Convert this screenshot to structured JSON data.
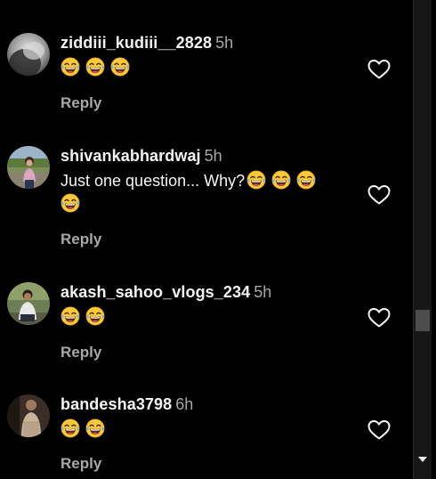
{
  "colors": {
    "background": "#000000",
    "text": "#f5f5f5",
    "secondary": "#a8a8a8",
    "scrollbar_track": "#171717",
    "scrollbar_thumb": "#4d4d4d"
  },
  "comments": [
    {
      "username": "ziddiii_kudiii__2828",
      "time": "5h",
      "text": "",
      "emoji_count": 3,
      "reply_label": "Reply",
      "avatar": "grey-blurred-avatar"
    },
    {
      "username": "shivankabhardwaj",
      "time": "5h",
      "text": "Just one question... Why?",
      "emoji_count": 4,
      "reply_label": "Reply",
      "avatar": "outdoor-photo-avatar"
    },
    {
      "username": "akash_sahoo_vlogs_234",
      "time": "5h",
      "text": "",
      "emoji_count": 2,
      "reply_label": "Reply",
      "avatar": "person-photo-avatar"
    },
    {
      "username": "bandesha3798",
      "time": "6h",
      "text": "",
      "emoji_count": 2,
      "reply_label": "Reply",
      "avatar": "person-photo-avatar"
    }
  ],
  "icons": {
    "emoji": "face-with-tears-of-joy-icon",
    "like": "heart-outline-icon",
    "scroll_up": "triangle-up-icon",
    "scroll_down": "triangle-down-icon"
  }
}
